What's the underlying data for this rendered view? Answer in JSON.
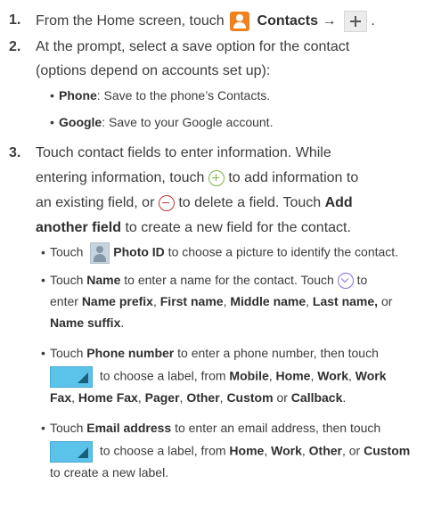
{
  "steps": [
    {
      "num": "1.",
      "lines": {
        "a": "From the Home screen, touch",
        "b": "Contacts →",
        "c": "."
      }
    },
    {
      "num": "2.",
      "line1": "At the prompt, select a save option for the contact",
      "line2": "(options depend on accounts set up):",
      "bullets": [
        {
          "bold": "Phone",
          "text": ": Save to the phone’s Contacts."
        },
        {
          "bold": "Google",
          "text": ": Save to your Google account."
        }
      ]
    },
    {
      "num": "3.",
      "line1": "Touch contact fields to enter information. While",
      "line2a": "entering information, touch",
      "line2b": "to add information to",
      "line3a": "an existing field, or",
      "line3b": "to delete a field. Touch",
      "line3c": "Add",
      "line4a": "another field",
      "line4b": " to create a new field for the contact.",
      "bullets": {
        "photo": {
          "pre": "Touch",
          "bold": "Photo ID",
          "text": " to choose a picture to identify the contact."
        },
        "name": {
          "pre": "Touch ",
          "bold": "Name",
          "text": " to enter a name for the contact. Touch",
          "l2pre": "enter ",
          "b1": "Name prefix",
          "s1": ", ",
          "b2": "First name",
          "s2": ", ",
          "b3": "Middle name",
          "s3": ", ",
          "b4": "Last name,",
          "s4": " or",
          "b5": "Name suffix",
          "s5": "."
        },
        "phone": {
          "pre": "Touch ",
          "bold": "Phone number",
          "text": " to enter a phone number, then touch",
          "l2": " to choose a label, from ",
          "b1": "Mobile",
          "s1": ", ",
          "b2": "Home",
          "s2": ", ",
          "b3": "Work",
          "s3": ", ",
          "b4": "Work",
          "b5": "Fax",
          "s5": ", ",
          "b6": "Home Fax",
          "s6": ", ",
          "b7": "Pager",
          "s7": ", ",
          "b8": "Other",
          "s8": ", ",
          "b9": "Custom",
          "s9": " or ",
          "b10": "Callback",
          "s10": "."
        },
        "email": {
          "pre": "Touch ",
          "bold": "Email address",
          "text": " to enter an email address, then touch",
          "l2": " to choose a label, from ",
          "b1": "Home",
          "s1": ", ",
          "b2": "Work",
          "s2": ", ",
          "b3": "Other",
          "s3": ", or ",
          "b4": "Custom",
          "l3": "to create a new label."
        }
      }
    }
  ],
  "icons": [
    "contacts-icon",
    "add-plus-icon",
    "add-field-plus-icon",
    "delete-field-minus-icon",
    "photo-id-icon",
    "expand-chevron-icon",
    "label-selector-icon"
  ]
}
